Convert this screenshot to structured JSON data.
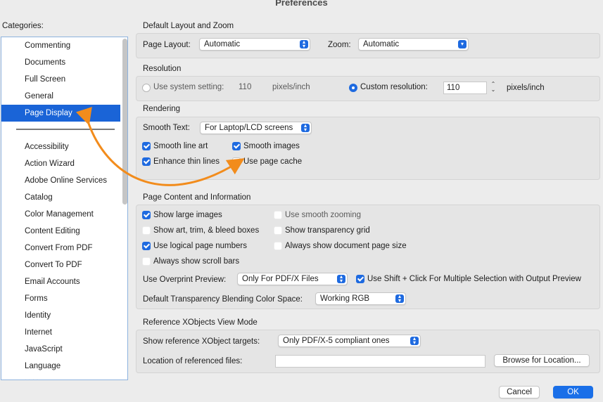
{
  "window": {
    "title": "Preferences"
  },
  "sidebar": {
    "label": "Categories:",
    "selected_index": 4,
    "items_top": [
      {
        "label": "Commenting"
      },
      {
        "label": "Documents"
      },
      {
        "label": "Full Screen"
      },
      {
        "label": "General"
      },
      {
        "label": "Page Display"
      }
    ],
    "items_bottom": [
      {
        "label": "Accessibility"
      },
      {
        "label": "Action Wizard"
      },
      {
        "label": "Adobe Online Services"
      },
      {
        "label": "Catalog"
      },
      {
        "label": "Color Management"
      },
      {
        "label": "Content Editing"
      },
      {
        "label": "Convert From PDF"
      },
      {
        "label": "Convert To PDF"
      },
      {
        "label": "Email Accounts"
      },
      {
        "label": "Forms"
      },
      {
        "label": "Identity"
      },
      {
        "label": "Internet"
      },
      {
        "label": "JavaScript"
      },
      {
        "label": "Language"
      }
    ]
  },
  "layout_zoom": {
    "title": "Default Layout and Zoom",
    "page_layout_label": "Page Layout:",
    "page_layout_value": "Automatic",
    "zoom_label": "Zoom:",
    "zoom_value": "Automatic"
  },
  "resolution": {
    "title": "Resolution",
    "system_label": "Use system setting:",
    "system_value": "110",
    "system_unit": "pixels/inch",
    "custom_label": "Custom resolution:",
    "custom_value": "110",
    "custom_unit": "pixels/inch",
    "selected": "custom"
  },
  "rendering": {
    "title": "Rendering",
    "smooth_text_label": "Smooth Text:",
    "smooth_text_value": "For Laptop/LCD screens",
    "options": {
      "smooth_line_art": {
        "label": "Smooth line art",
        "checked": true
      },
      "smooth_images": {
        "label": "Smooth images",
        "checked": true
      },
      "enhance_thin_lines": {
        "label": "Enhance thin lines",
        "checked": true
      },
      "use_page_cache": {
        "label": "Use page cache",
        "checked": false
      }
    }
  },
  "page_content": {
    "title": "Page Content and Information",
    "options": {
      "show_large_images": {
        "label": "Show large images",
        "checked": true
      },
      "use_smooth_zooming": {
        "label": "Use smooth zooming",
        "checked": false,
        "enabled": false
      },
      "show_art_trim_bleed": {
        "label": "Show art, trim, & bleed boxes",
        "checked": false
      },
      "show_transparency_grid": {
        "label": "Show transparency grid",
        "checked": false
      },
      "use_logical_page_numbers": {
        "label": "Use logical page numbers",
        "checked": true
      },
      "always_show_doc_page_size": {
        "label": "Always show document page size",
        "checked": false
      },
      "always_show_scroll_bars": {
        "label": "Always show scroll bars",
        "checked": false
      }
    },
    "overprint_label": "Use Overprint Preview:",
    "overprint_value": "Only For PDF/X Files",
    "shift_click": {
      "label": "Use Shift + Click For Multiple Selection with Output Preview",
      "checked": true
    },
    "blending_label": "Default Transparency Blending Color Space:",
    "blending_value": "Working RGB"
  },
  "xobjects": {
    "title": "Reference XObjects View Mode",
    "targets_label": "Show reference XObject targets:",
    "targets_value": "Only PDF/X-5 compliant ones",
    "location_label": "Location of referenced files:",
    "location_value": "",
    "browse_label": "Browse for Location..."
  },
  "footer": {
    "cancel_label": "Cancel",
    "ok_label": "OK"
  },
  "colors": {
    "accent": "#1e6ae0",
    "annotation_arrow": "#f28c1c",
    "selected_row": "#1a64d7"
  }
}
